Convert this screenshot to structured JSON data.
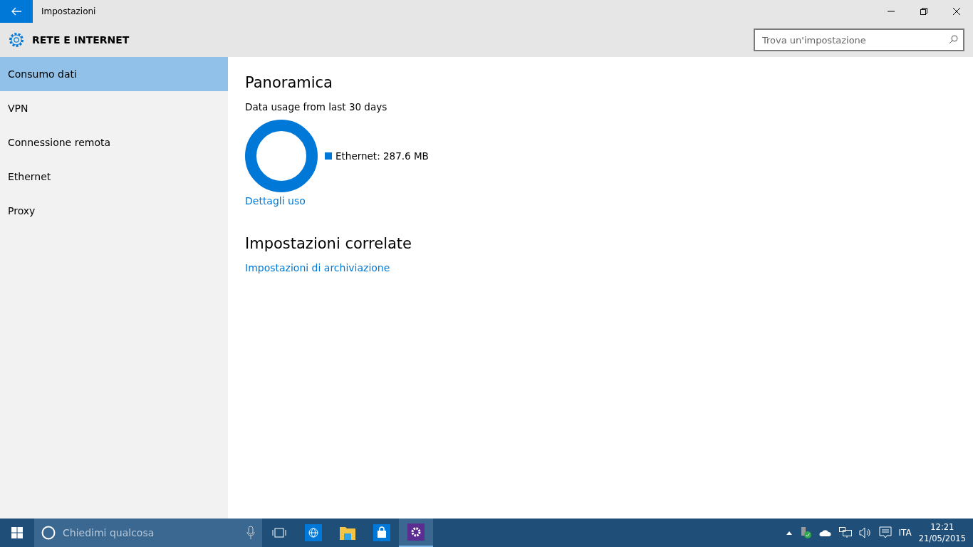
{
  "window": {
    "title": "Impostazioni"
  },
  "header": {
    "title": "RETE E INTERNET",
    "search": {
      "placeholder": "Trova un'impostazione"
    }
  },
  "sidebar": {
    "items": [
      {
        "label": "Consumo dati",
        "selected": true
      },
      {
        "label": "VPN",
        "selected": false
      },
      {
        "label": "Connessione remota",
        "selected": false
      },
      {
        "label": "Ethernet",
        "selected": false
      },
      {
        "label": "Proxy",
        "selected": false
      }
    ]
  },
  "content": {
    "overview": {
      "heading": "Panoramica",
      "subtitle": "Data usage from last 30 days",
      "legend": [
        {
          "label": "Ethernet: 287.6 MB",
          "color": "#0078d7"
        }
      ],
      "link": "Dettagli uso"
    },
    "related": {
      "heading": "Impostazioni correlate",
      "links": [
        "Impostazioni di archiviazione"
      ]
    }
  },
  "taskbar": {
    "search_placeholder": "Chiedimi qualcosa",
    "apps": [
      {
        "kind": "browser",
        "active": false
      },
      {
        "kind": "folder",
        "active": false
      },
      {
        "kind": "store",
        "active": false
      },
      {
        "kind": "settings",
        "active": true
      }
    ],
    "language": "ITA",
    "time": "12:21",
    "date": "21/05/2015"
  }
}
